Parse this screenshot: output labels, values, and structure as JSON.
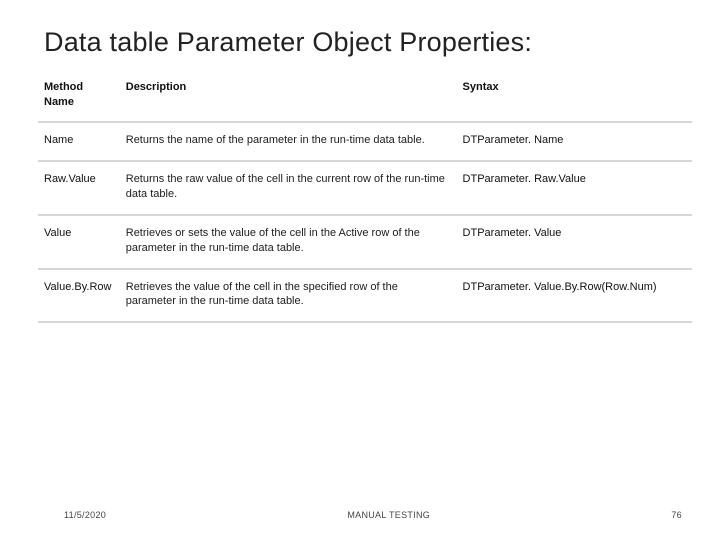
{
  "title": "Data table Parameter Object Properties:",
  "table": {
    "headers": [
      "Method Name",
      "Description",
      "Syntax"
    ],
    "rows": [
      {
        "name": "Name",
        "description": "Returns the name of the parameter in the run-time data table.",
        "syntax": "DTParameter. Name"
      },
      {
        "name": "Raw.Value",
        "description": "Returns the raw value of the cell in the current row of the run-time data table.",
        "syntax": "DTParameter. Raw.Value"
      },
      {
        "name": "Value",
        "description": "Retrieves or sets the value of the cell in the Active row of the parameter in the run-time data table.",
        "syntax": "DTParameter. Value"
      },
      {
        "name": "Value.By.Row",
        "description": "Retrieves the value of the cell in the specified row of the parameter in the run-time data table.",
        "syntax": "DTParameter. Value.By.Row(Row.Num)"
      }
    ]
  },
  "footer": {
    "date": "11/5/2020",
    "center": "MANUAL TESTING",
    "page": "76"
  }
}
